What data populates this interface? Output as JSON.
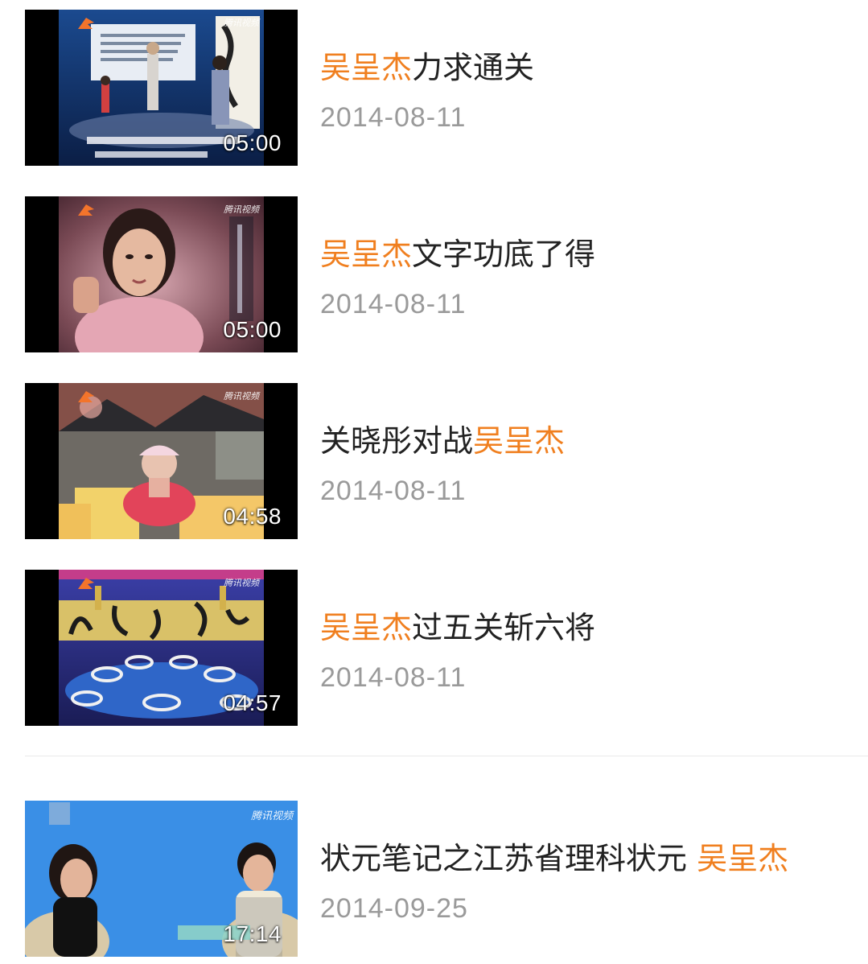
{
  "videos": [
    {
      "title_pre": "",
      "title_highlight": "吴呈杰",
      "title_post": "力求通关",
      "date": "2014-08-11",
      "duration": "05:00",
      "watermark": "腾讯视频"
    },
    {
      "title_pre": "",
      "title_highlight": "吴呈杰",
      "title_post": "文字功底了得",
      "date": "2014-08-11",
      "duration": "05:00",
      "watermark": "腾讯视频"
    },
    {
      "title_pre": "关晓彤对战",
      "title_highlight": "吴呈杰",
      "title_post": "",
      "date": "2014-08-11",
      "duration": "04:58",
      "watermark": "腾讯视频"
    },
    {
      "title_pre": "",
      "title_highlight": "吴呈杰",
      "title_post": "过五关斩六将",
      "date": "2014-08-11",
      "duration": "04:57",
      "watermark": "腾讯视频"
    },
    {
      "title_pre": "状元笔记之江苏省理科状元 ",
      "title_highlight": "吴呈杰",
      "title_post": "",
      "date": "2014-09-25",
      "duration": "17:14",
      "watermark": "腾讯视频"
    }
  ],
  "colors": {
    "highlight": "#f07f1f",
    "date": "#9a9a9a",
    "title": "#222222"
  }
}
